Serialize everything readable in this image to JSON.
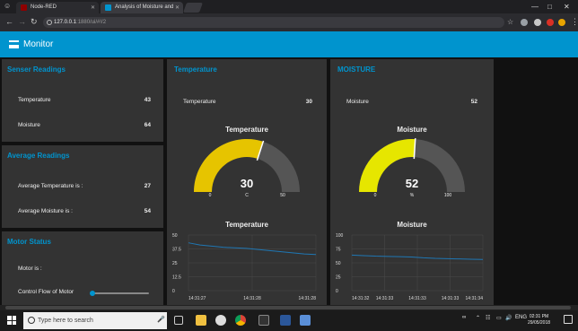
{
  "browser": {
    "tabs": [
      {
        "label": "Node-RED",
        "icon": "node-red-icon",
        "color": "#8f0000"
      },
      {
        "label": "Analysis of Moisture and",
        "icon": "dashboard-icon",
        "color": "#0094ce"
      }
    ],
    "url_host": "127.0.0.1",
    "url_path": ":1880/ui/#!/2"
  },
  "app": {
    "title": "Monitor",
    "accent": "#0094ce"
  },
  "sensor_readings": {
    "title": "Senser Readings",
    "rows": [
      {
        "label": "Temperature",
        "value": "43"
      },
      {
        "label": "Moisture",
        "value": "64"
      }
    ]
  },
  "average_readings": {
    "title": "Average Readings",
    "rows": [
      {
        "label": "Average Temperature is :",
        "value": "27"
      },
      {
        "label": "Average Moisture is :",
        "value": "54"
      }
    ]
  },
  "motor_status": {
    "title": "Motor Status",
    "status_label": "Motor is :",
    "control_label": "Control Flow of Motor",
    "control_value": 0
  },
  "temperature_group": {
    "title": "Temperature",
    "text_label": "Temperature",
    "text_value": "30",
    "gauge_title": "Temperature",
    "gauge_value": "30",
    "gauge_unit": "C",
    "gauge_min": "0",
    "gauge_max": "50",
    "gauge_color": "#e6c400",
    "chart_title": "Temperature"
  },
  "moisture_group": {
    "title": "MOISTURE",
    "text_label": "Moisture",
    "text_value": "52",
    "gauge_title": "Moisture",
    "gauge_value": "52",
    "gauge_unit": "%",
    "gauge_min": "0",
    "gauge_max": "100",
    "gauge_color": "#e6e600",
    "chart_title": "Moisture"
  },
  "chart_data": [
    {
      "type": "line",
      "title": "Temperature",
      "ylim": [
        0,
        50
      ],
      "yticks": [
        "50",
        "37.5",
        "25",
        "12.5",
        "0"
      ],
      "xticks": [
        "14:31:27",
        "14:31:28",
        "14:31:28"
      ],
      "series": [
        {
          "values": [
            43,
            41,
            40,
            39,
            38.5,
            38,
            37,
            36,
            35,
            34,
            33,
            32.5
          ]
        }
      ],
      "color": "#1f77b4"
    },
    {
      "type": "line",
      "title": "Moisture",
      "ylim": [
        0,
        100
      ],
      "yticks": [
        "100",
        "75",
        "50",
        "25",
        "0"
      ],
      "xticks": [
        "14:31:32",
        "14:31:33",
        "14:31:33",
        "14:31:33",
        "14:31:34"
      ],
      "series": [
        {
          "values": [
            64,
            63,
            62,
            61.5,
            61,
            60.5,
            59,
            58,
            57.5,
            57,
            56.5,
            56
          ]
        }
      ],
      "color": "#1f77b4"
    }
  ],
  "taskbar": {
    "search_placeholder": "Type here to search",
    "lang": "ENG",
    "time": "02:31 PM",
    "date": "29/05/2018"
  }
}
